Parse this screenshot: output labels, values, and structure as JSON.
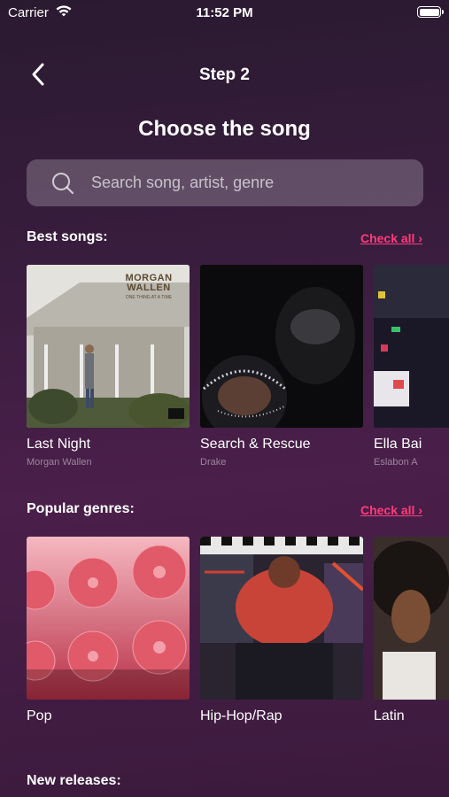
{
  "status_bar": {
    "carrier": "Carrier",
    "time": "11:52 PM"
  },
  "nav": {
    "title": "Step 2"
  },
  "page": {
    "title": "Choose the song"
  },
  "search": {
    "placeholder": "Search song, artist, genre"
  },
  "sections": {
    "best_songs": {
      "title": "Best songs:",
      "check_all": "Check all ›",
      "items": [
        {
          "title": "Last Night",
          "artist": "Morgan Wallen",
          "cover_text": "MORGAN WALLEN",
          "cover_sub": "ONE THING AT A TIME"
        },
        {
          "title": "Search & Rescue",
          "artist": "Drake"
        },
        {
          "title": "Ella Bai",
          "artist": "Eslabon A"
        }
      ]
    },
    "popular_genres": {
      "title": "Popular genres:",
      "check_all": "Check all ›",
      "items": [
        {
          "title": "Pop"
        },
        {
          "title": "Hip-Hop/Rap"
        },
        {
          "title": "Latin"
        }
      ]
    },
    "new_releases": {
      "title": "New releases:"
    }
  },
  "colors": {
    "accent": "#ff3b7a",
    "background": "#3a1d3f"
  }
}
